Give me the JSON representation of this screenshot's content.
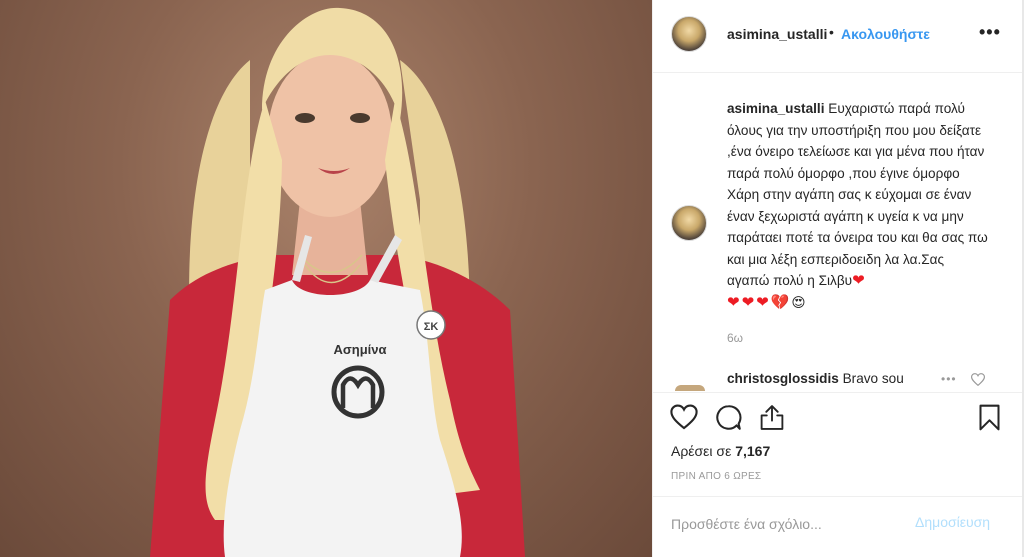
{
  "photo": {
    "apron_name": "Ασημίνα",
    "badge": "ΣΚ"
  },
  "header": {
    "username": "asimina_ustalli",
    "separator": "•",
    "follow_label": "Ακολουθήστε",
    "more_label": "•••"
  },
  "caption": {
    "username": "asimina_ustalli",
    "text": "Ευχαριστώ παρά πολύ όλους για την υποστήριξη που μου δείξατε ,ένα όνειρο τελείωσε και για μένα που ήταν παρά πολύ όμορφο ,που έγινε όμορφο Χάρη στην αγάπη σας κ εύχομαι σε έναν έναν ξεχωριστά αγάπη κ υγεία κ να μην παράταει ποτέ τα όνειρα του και θα σας πω και μια λέξη εσπεριδοειδη λα λα.Σας αγαπώ πολύ η Σιλβυ",
    "end_emoji": "❤",
    "hearts_line": "❤❤❤💔",
    "face_emoji": "😍",
    "time": "6ω"
  },
  "comment": {
    "username": "christosglossidis",
    "text": "Bravo sou",
    "more_label": "•••"
  },
  "actions": {
    "likes_prefix": "Αρέσει σε",
    "likes_count": "7,167",
    "posted": "ΠΡΙΝ ΑΠΟ 6 ΩΡΕΣ"
  },
  "add_comment": {
    "placeholder": "Προσθέστε ένα σχόλιο...",
    "post_label": "Δημοσίευση"
  },
  "colors": {
    "accent": "#3897f0",
    "heart": "#ed1c24",
    "muted": "#999999",
    "post_disabled": "#b2dffc"
  }
}
